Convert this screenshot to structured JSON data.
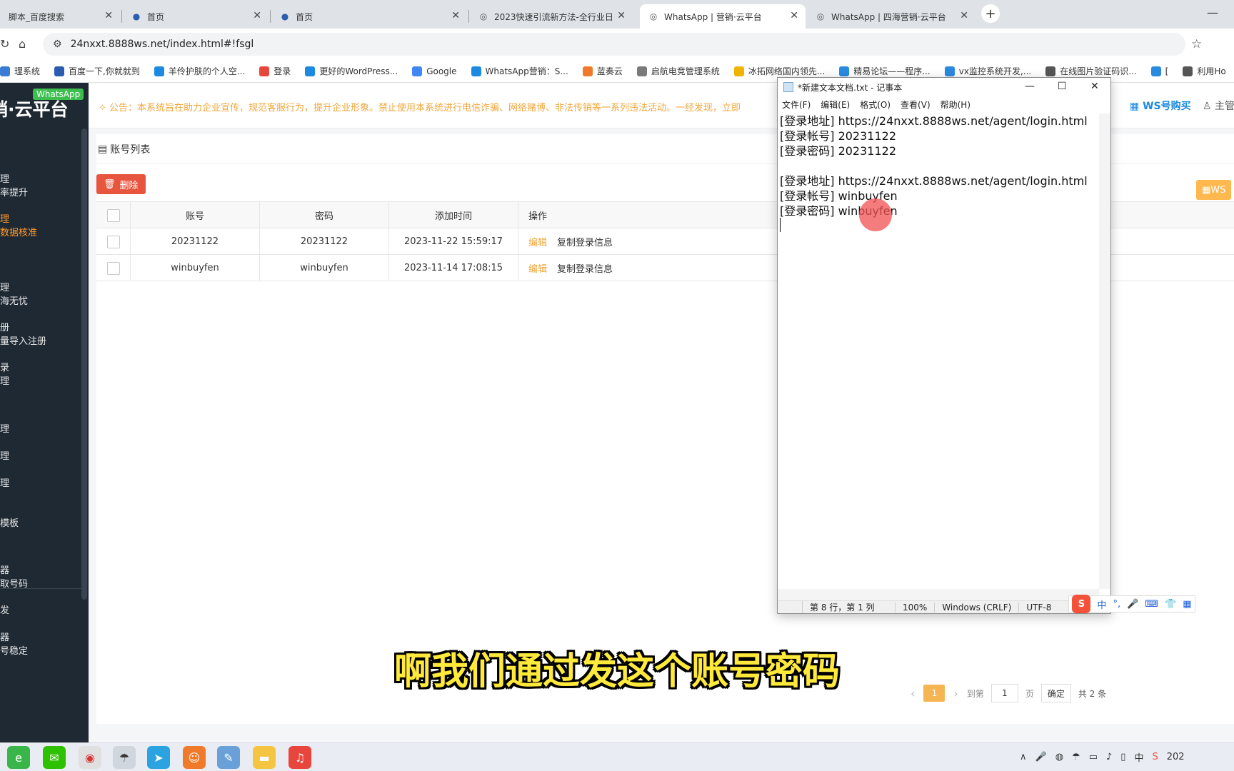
{
  "browser": {
    "tabs": [
      {
        "label": "脚本_百度搜索",
        "active": false
      },
      {
        "label": "首页",
        "active": false
      },
      {
        "label": "首页",
        "active": false
      },
      {
        "label": "2023快速引流新方法-全行业日",
        "active": false
      },
      {
        "label": "WhatsApp | 营销·云平台",
        "active": true
      },
      {
        "label": "WhatsApp | 四海营销·云平台",
        "active": false
      }
    ],
    "new_tab": "+",
    "url": "24nxxt.8888ws.net/index.html#!fsgl",
    "bookmarks": [
      {
        "label": "理系统",
        "color": "#3a7bd5"
      },
      {
        "label": "百度一下,你就就到",
        "color": "#2a5db0"
      },
      {
        "label": "羊伶护肤的个人空...",
        "color": "#1b8ae0"
      },
      {
        "label": "登录",
        "color": "#e8453c"
      },
      {
        "label": "更好的WordPress...",
        "color": "#1b8ae0"
      },
      {
        "label": "Google",
        "color": "#4285f4"
      },
      {
        "label": "WhatsApp营销：S...",
        "color": "#1b8ae0"
      },
      {
        "label": "蓝奏云",
        "color": "#f07a2a"
      },
      {
        "label": "启航电竞管理系统",
        "color": "#7a7a7a"
      },
      {
        "label": "冰拓网络国内领先...",
        "color": "#f0b400"
      },
      {
        "label": "精易论坛——程序...",
        "color": "#2a8ae0"
      },
      {
        "label": "vx监控系统开发,...",
        "color": "#2a8ae0"
      },
      {
        "label": "在线图片验证码识...",
        "color": "#555555"
      },
      {
        "label": "[",
        "color": "#2a8ae0"
      },
      {
        "label": "利用Ho",
        "color": "#555555"
      }
    ]
  },
  "sidebar": {
    "logo": "销·云平台",
    "badge": "WhatsApp",
    "items": [
      {
        "label": "理",
        "color": "normal"
      },
      {
        "label": "率提升",
        "color": "normal"
      },
      {
        "label": "理",
        "color": "orange"
      },
      {
        "label": "数据核准",
        "color": "orange"
      },
      {
        "label": "理",
        "color": "normal"
      },
      {
        "label": "海无忧",
        "color": "normal"
      },
      {
        "label": "册",
        "color": "normal"
      },
      {
        "label": "量导入注册",
        "color": "normal"
      },
      {
        "label": "录",
        "color": "normal"
      },
      {
        "label": "理",
        "color": "normal"
      },
      {
        "label": "理",
        "color": "normal"
      },
      {
        "label": "理",
        "color": "normal"
      },
      {
        "label": "理",
        "color": "normal"
      },
      {
        "label": "模板",
        "color": "normal"
      },
      {
        "label": "器",
        "color": "normal"
      },
      {
        "label": "取号码",
        "color": "normal"
      },
      {
        "label": "发",
        "color": "normal"
      },
      {
        "label": "器",
        "color": "normal"
      },
      {
        "label": "号稳定",
        "color": "normal"
      }
    ]
  },
  "notice": {
    "text": "公告：本系统旨在助力企业宣传，规范客服行为，提升企业形象。禁止使用本系统进行电信诈骗、网络赌博、非法传销等一系列违法活动。一经发现，立即",
    "ws_buy": "WS号购买",
    "admin": "主管"
  },
  "content": {
    "title": "账号列表",
    "delete_label": "删除",
    "ws_btn": "WS",
    "columns": [
      "账号",
      "密码",
      "添加时间",
      "操作"
    ],
    "rows": [
      {
        "account": "20231122",
        "password": "20231122",
        "time": "2023-11-22 15:59:17",
        "edit": "编辑",
        "copy": "复制登录信息"
      },
      {
        "account": "winbuyfen",
        "password": "winbuyfen",
        "time": "2023-11-14 17:08:15",
        "edit": "编辑",
        "copy": "复制登录信息"
      }
    ],
    "pager": {
      "current": "1",
      "goto": "到第",
      "page_input": "1",
      "page_unit": "页",
      "confirm": "确定",
      "total": "共 2 条"
    }
  },
  "notepad": {
    "title": "*新建文本文档.txt - 记事本",
    "menu": [
      "文件(F)",
      "编辑(E)",
      "格式(O)",
      "查看(V)",
      "帮助(H)"
    ],
    "lines": [
      "[登录地址] https://24nxxt.8888ws.net/agent/login.html",
      "[登录帐号] 20231122",
      "[登录密码] 20231122",
      "",
      "[登录地址] https://24nxxt.8888ws.net/agent/login.html",
      "[登录帐号] winbuyfen",
      "[登录密码] winbuyfen"
    ],
    "status": {
      "position": "第 8 行，第 1 列",
      "zoom": "100%",
      "eol": "Windows (CRLF)",
      "encoding": "UTF-8"
    }
  },
  "ime": {
    "mode": "中",
    "punct": "°,"
  },
  "subtitle": "啊我们通过发这个账号密码",
  "taskbar": {
    "tray_lang": "中",
    "tray_year": "202"
  }
}
